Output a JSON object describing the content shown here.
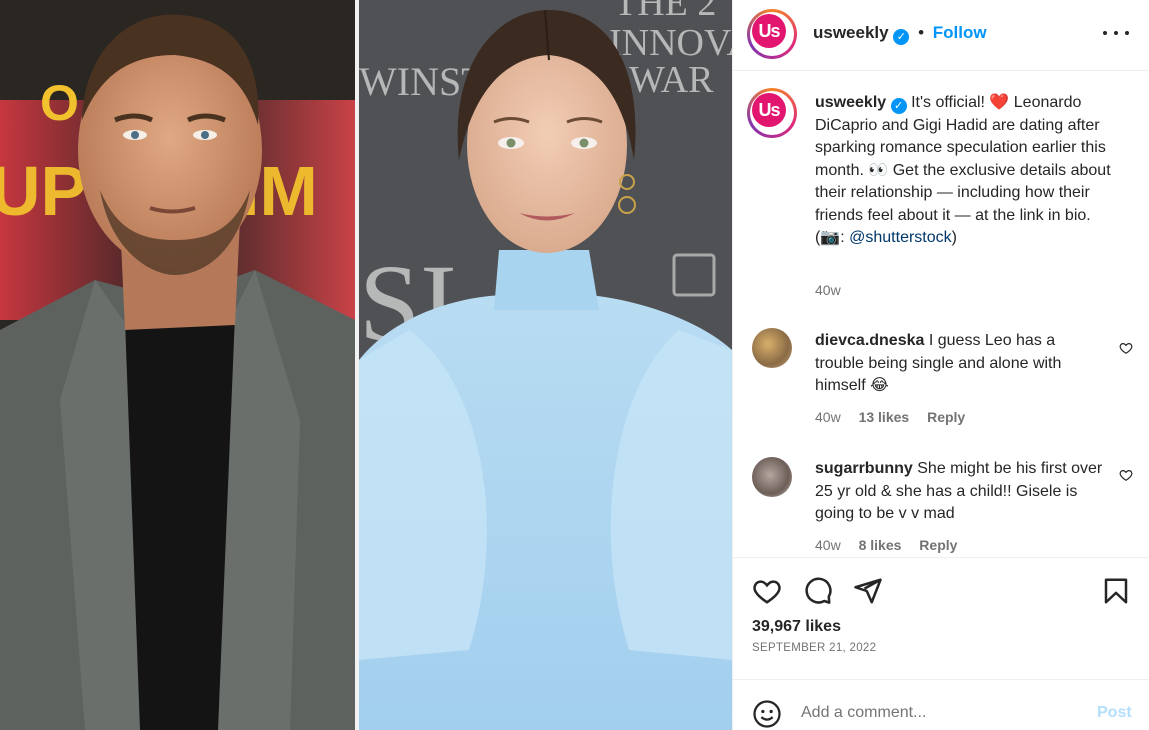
{
  "post": {
    "username": "usweekly",
    "avatar_text": "Us",
    "follow_label": "Follow",
    "separator": "•",
    "more_icon": "more-options-icon",
    "caption": {
      "username": "usweekly",
      "text_before": "It's official! ❤️ Leonardo DiCaprio and Gigi Hadid are dating after sparking romance speculation earlier this month. 👀 Get the exclusive details about their relationship — including how their friends feel about it — at the link in bio. (📷: ",
      "mention": "@shutterstock",
      "text_after": ")",
      "time": "40w"
    },
    "comments": [
      {
        "username": "dievca.dneska",
        "text": "I guess Leo has a trouble being single and alone with himself 😂",
        "time": "40w",
        "likes": "13 likes",
        "reply": "Reply"
      },
      {
        "username": "sugarrbunny",
        "text": "She might be his first over 25 yr old & she has a child!! Gisele is going to be v v mad",
        "time": "40w",
        "likes": "8 likes",
        "reply": "Reply"
      }
    ],
    "likes_count": "39,967 likes",
    "date": "SEPTEMBER 21, 2022",
    "add_comment_placeholder": "Add a comment...",
    "post_button": "Post"
  },
  "colors": {
    "accent": "#0095f6",
    "brand": "#e2166f",
    "heart": "#ed4956"
  }
}
